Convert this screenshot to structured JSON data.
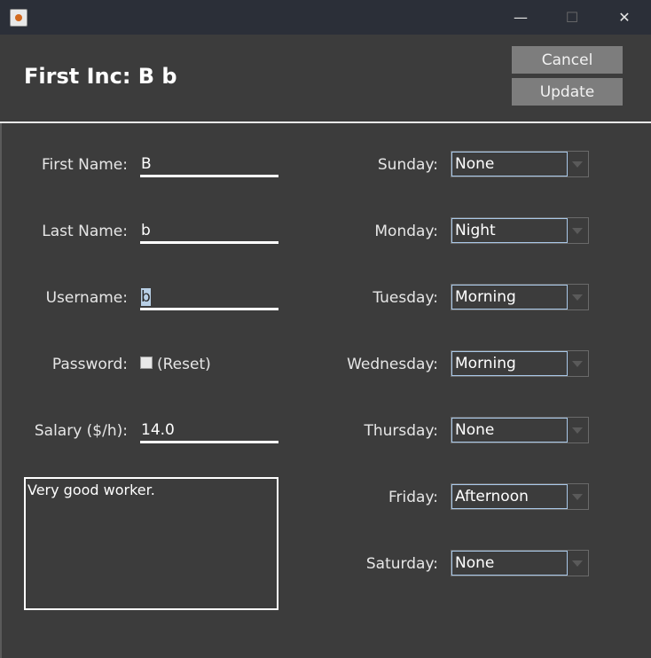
{
  "window": {
    "minimize_glyph": "—",
    "maximize_glyph": "☐",
    "close_glyph": "✕"
  },
  "header": {
    "title": "First Inc: B b",
    "cancel_label": "Cancel",
    "update_label": "Update"
  },
  "form": {
    "first_name": {
      "label": "First Name:",
      "value": "B"
    },
    "last_name": {
      "label": "Last Name:",
      "value": "b"
    },
    "username": {
      "label": "Username:",
      "value": "b"
    },
    "password": {
      "label": "Password:",
      "reset_label": "(Reset)",
      "checked": false
    },
    "salary": {
      "label": "Salary ($/h):",
      "value": "14.0"
    },
    "notes": "Very good worker."
  },
  "schedule": [
    {
      "day": "Sunday:",
      "shift": "None"
    },
    {
      "day": "Monday:",
      "shift": "Night"
    },
    {
      "day": "Tuesday:",
      "shift": "Morning"
    },
    {
      "day": "Wednesday:",
      "shift": "Morning"
    },
    {
      "day": "Thursday:",
      "shift": "None"
    },
    {
      "day": "Friday:",
      "shift": "Afternoon"
    },
    {
      "day": "Saturday:",
      "shift": "None"
    }
  ],
  "colors": {
    "background": "#3c3c3c",
    "titlebar": "#2b2f38",
    "button": "#7d7d7d"
  }
}
